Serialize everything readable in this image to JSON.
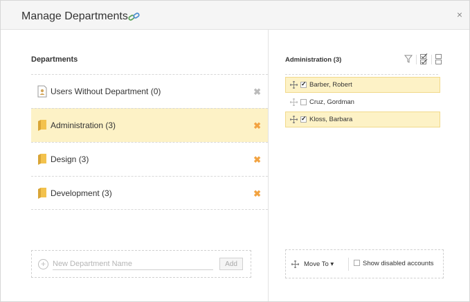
{
  "dialog": {
    "title": "Manage Departments",
    "title_icon": "link-icon",
    "close_label": "×"
  },
  "departments": {
    "heading": "Departments",
    "items": [
      {
        "label": "Users Without Department (0)",
        "icon": "user-card-icon",
        "selected": false,
        "remove": "grey"
      },
      {
        "label": "Administration (3)",
        "icon": "folder-icon",
        "selected": true,
        "remove": "orange"
      },
      {
        "label": "Design (3)",
        "icon": "folder-icon",
        "selected": false,
        "remove": "orange"
      },
      {
        "label": "Development (3)",
        "icon": "folder-icon",
        "selected": false,
        "remove": "orange"
      }
    ],
    "remove_glyph": "✖",
    "new_placeholder": "New Department Name",
    "add_label": "Add"
  },
  "members": {
    "heading": "Administration (3)",
    "tools": [
      "filter-icon",
      "check-all-icon",
      "uncheck-all-icon"
    ],
    "users": [
      {
        "name": "Barber, Robert",
        "checked": true
      },
      {
        "name": "Cruz, Gordman",
        "checked": false
      },
      {
        "name": "Kloss, Barbara",
        "checked": true
      }
    ],
    "move_to_label": "Move To ▾",
    "show_disabled_label": "Show disabled accounts",
    "show_disabled_checked": false
  },
  "colors": {
    "selected_bg": "#fdf2c6",
    "remove_orange": "#f2a341",
    "remove_grey": "#bbbbbb"
  }
}
